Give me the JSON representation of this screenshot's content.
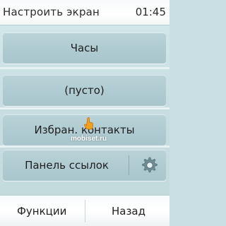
{
  "status_bar": {
    "title": "Настроить экран",
    "time": "01:45"
  },
  "menu": {
    "items": [
      {
        "label": "Часы"
      },
      {
        "label": "(пусто)"
      },
      {
        "label": "Избран. контакты"
      },
      {
        "label": "Панель ссылок",
        "icon": "gear-icon"
      }
    ]
  },
  "softkeys": {
    "left_label": "Функции",
    "right_label": "Назад"
  },
  "watermark": {
    "text": "mobiset.ru",
    "icon": "hand-pointer-icon"
  },
  "colors": {
    "item_fill": "#afcbd1",
    "background": "#c7dde1",
    "bar": "#ffffff"
  }
}
